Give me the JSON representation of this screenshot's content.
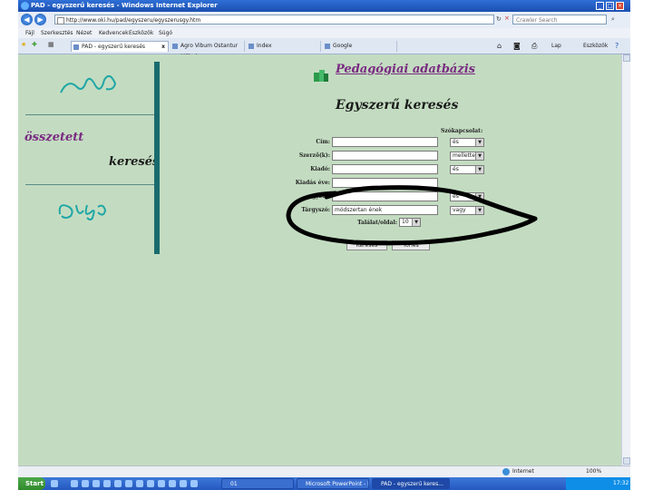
{
  "window": {
    "title": "PAD - egyszerű keresés - Windows Internet Explorer"
  },
  "address_bar": {
    "url": "http://www.oki.hu/pad/egyszeru/egyszerusgy.htm",
    "search_placeholder": "Crawler Search"
  },
  "menu": [
    "Fájl",
    "Szerkesztés",
    "Nézet",
    "Kedvencek",
    "Eszközök",
    "Súgó"
  ],
  "tabs": [
    {
      "label": "PAD - egyszerű keresés",
      "close": "x"
    },
    {
      "label": "Agro Vibum Ostantur Műhely..."
    },
    {
      "label": "Index"
    },
    {
      "label": "Google"
    }
  ],
  "toolbar": {
    "page": "Lap",
    "tools": "Eszközök"
  },
  "sidebar": {
    "logo": "PAD",
    "link_complex_top": "összetett",
    "link_complex_bottom": "keresés",
    "link_help": "Súgó"
  },
  "header": {
    "db_title": "Pedagógiai adatbázis"
  },
  "page_title": "Egyszerű keresés",
  "form": {
    "operator_header": "Szókapcsolat:",
    "fields": [
      {
        "label": "Cím:",
        "value": "",
        "operator": "és"
      },
      {
        "label": "Szerző(k):",
        "value": "",
        "operator": "mellette"
      },
      {
        "label": "Kiadó:",
        "value": "",
        "operator": "és"
      },
      {
        "label": "Kiadás éve:",
        "value": ""
      },
      {
        "label": "...gyzet:",
        "value": "",
        "operator": "és"
      },
      {
        "label": "Tárgyszó:",
        "value": "módszertan ének",
        "operator": "vagy"
      }
    ],
    "results_label": "Találat/oldal:",
    "results_value": "10",
    "search_button": "Keresés",
    "clear_button": "Törlés"
  },
  "statusbar": {
    "zone": "Internet",
    "zoom": "100%"
  },
  "taskbar": {
    "start": "Start",
    "items": [
      {
        "label": "01"
      },
      {
        "label": "Microsoft PowerPoint - [...]"
      },
      {
        "label": "PAD - egyszerű keres..."
      }
    ],
    "clock": "17:32"
  },
  "colors": {
    "page_bg": "#c3dcc1",
    "title_purple": "#7a2a82",
    "side_bar": "#1a6b6e",
    "teal_logo": "#1fa6a6"
  },
  "annotation": {
    "shape": "hand-drawn ellipse",
    "color": "#000000",
    "around": "Tárgyszó row"
  }
}
